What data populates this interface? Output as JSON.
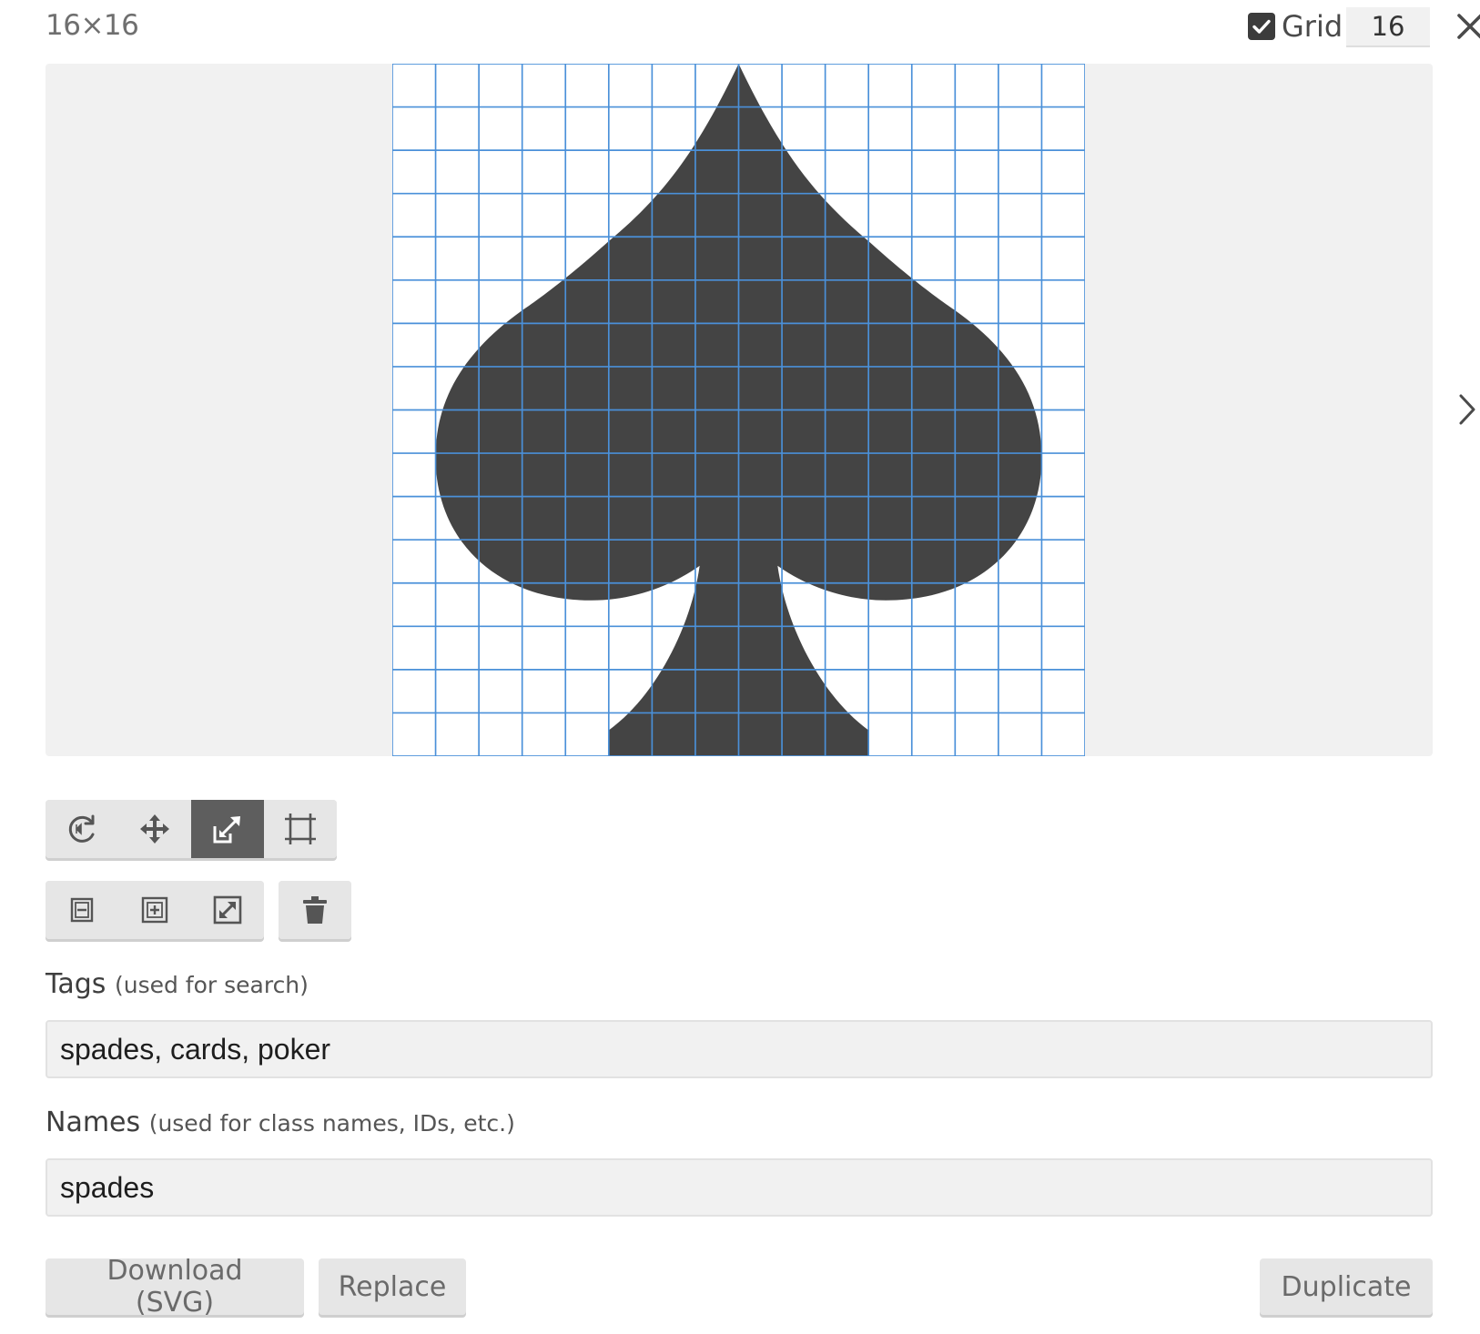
{
  "header": {
    "size_label": "16×16",
    "grid_label": "Grid",
    "grid_checked": true,
    "grid_size": "16"
  },
  "icons": {
    "close": "close-icon",
    "next": "chevron-right-icon",
    "checkbox": "checkbox-checked-icon"
  },
  "colors": {
    "glyph": "#444444",
    "grid_lines": "#4a90d9",
    "canvas_bg": "#f1f1f1",
    "active_tool": "#5e5e5e"
  },
  "toolbar_transform": [
    {
      "icon": "rotate-icon",
      "active": false
    },
    {
      "icon": "move-icon",
      "active": false
    },
    {
      "icon": "resize-icon",
      "active": true
    },
    {
      "icon": "crop-icon",
      "active": false
    }
  ],
  "toolbar_scale": [
    {
      "icon": "zoom-out-icon"
    },
    {
      "icon": "zoom-in-icon"
    },
    {
      "icon": "fit-icon"
    }
  ],
  "toolbar_delete": [
    {
      "icon": "trash-icon"
    }
  ],
  "tags": {
    "label": "Tags",
    "hint": "(used for search)",
    "value": "spades, cards, poker"
  },
  "names": {
    "label": "Names",
    "hint": "(used for class names, IDs, etc.)",
    "value": "spades"
  },
  "buttons": {
    "download": "Download (SVG)",
    "replace": "Replace",
    "duplicate": "Duplicate"
  }
}
